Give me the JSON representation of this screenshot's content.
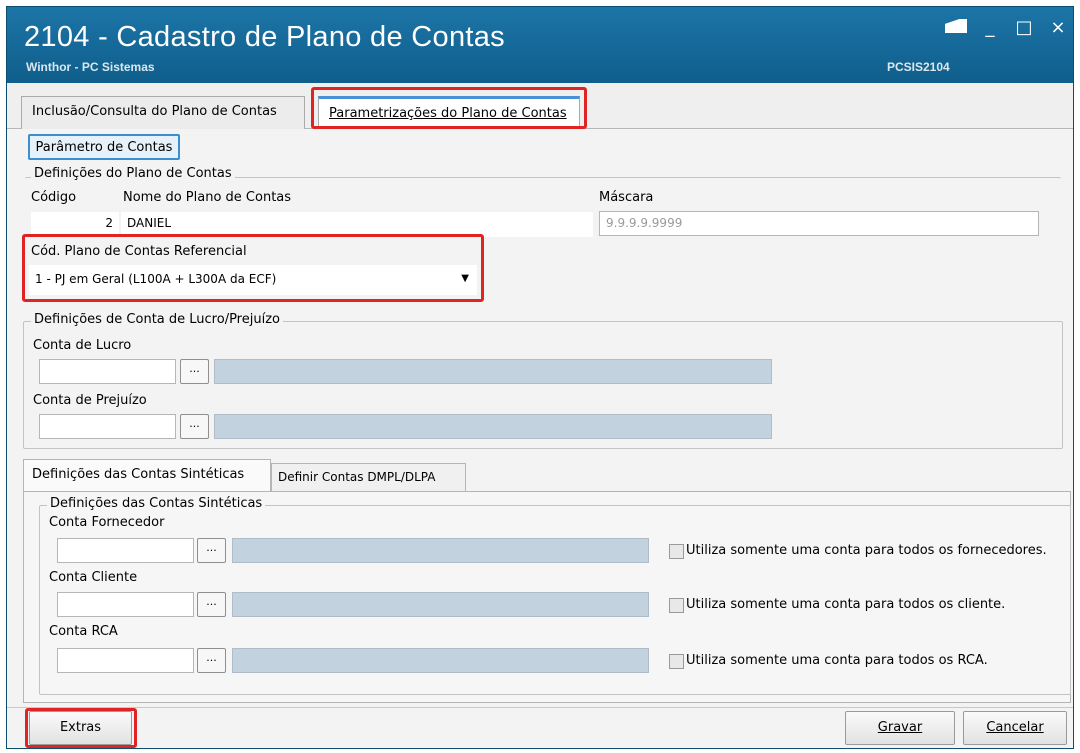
{
  "window": {
    "title": "2104 - Cadastro de Plano de Contas",
    "subtitle": "Winthor - PC Sistemas",
    "code": "PCSIS2104",
    "controls": {
      "restore_icon": "restore-icon",
      "minimize": "_",
      "maximize": "□",
      "close": "×"
    }
  },
  "tabs": {
    "first": "Inclusão/Consulta do Plano de Contas",
    "second": "Parametrizações do Plano de Contas"
  },
  "param_button": "Parâmetro de Contas",
  "plan_group": {
    "title": "Definições do Plano de Contas",
    "code_label": "Código",
    "code_value": "2",
    "name_label": "Nome do Plano de Contas",
    "name_value": "DANIEL",
    "mask_label": "Máscara",
    "mask_value": "9.9.9.9.9999",
    "ref_label": "Cód. Plano de Contas Referencial",
    "ref_value": "1 - PJ em Geral (L100A + L300A da ECF)"
  },
  "profit_group": {
    "title": "Definições de Conta de Lucro/Prejuízo",
    "profit_label": "Conta de Lucro",
    "loss_label": "Conta de Prejuízo",
    "dots": "..."
  },
  "inner_tabs": {
    "first": "Definições das Contas Sintéticas",
    "second": "Definir Contas DMPL/DLPA"
  },
  "synthetic_group": {
    "title": "Definições das Contas Sintéticas",
    "supplier_label": "Conta Fornecedor",
    "supplier_check": "Utiliza somente uma conta para todos os fornecedores.",
    "client_label": "Conta Cliente",
    "client_check": "Utiliza somente uma conta para todos os cliente.",
    "rca_label": "Conta RCA",
    "rca_check": "Utiliza somente uma conta para todos os RCA."
  },
  "footer": {
    "extras": "Extras",
    "save": "Gravar",
    "cancel": "Cancelar"
  }
}
